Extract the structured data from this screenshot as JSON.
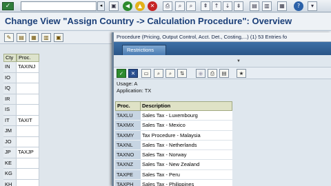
{
  "std_toolbar": {
    "buttons": [
      "back",
      "exit",
      "cancel",
      "print",
      "find",
      "find-next",
      "first-page",
      "previous-page",
      "next-page",
      "last-page",
      "create-session",
      "shortcut",
      "help",
      "customize"
    ]
  },
  "title": "Change View \"Assign Country -> Calculation Procedure\": Overview",
  "background_table": {
    "headers": [
      "Cty",
      "Proc."
    ],
    "rows": [
      {
        "cty": "IN",
        "proc": "TAXINJ"
      },
      {
        "cty": "IO",
        "proc": ""
      },
      {
        "cty": "IQ",
        "proc": ""
      },
      {
        "cty": "IR",
        "proc": ""
      },
      {
        "cty": "IS",
        "proc": ""
      },
      {
        "cty": "IT",
        "proc": "TAXIT"
      },
      {
        "cty": "JM",
        "proc": ""
      },
      {
        "cty": "JO",
        "proc": ""
      },
      {
        "cty": "JP",
        "proc": "TAXJP"
      },
      {
        "cty": "KE",
        "proc": ""
      },
      {
        "cty": "KG",
        "proc": ""
      },
      {
        "cty": "KH",
        "proc": ""
      }
    ]
  },
  "popup": {
    "title": "Procedure (Pricing, Output Control, Acct. Det., Costing,...) (1)   53 Entries fo",
    "tab_label": "Restrictions",
    "usage_line": "Usage: A",
    "application_line": "Application: TX",
    "columns": {
      "proc": "Proc.",
      "desc": "Description"
    },
    "rows": [
      {
        "proc": "TAXLU",
        "desc": "Sales Tax - Luxembourg"
      },
      {
        "proc": "TAXMX",
        "desc": "Sales Tax - Mexico"
      },
      {
        "proc": "TAXMY",
        "desc": "Tax Procedure - Malaysia"
      },
      {
        "proc": "TAXNL",
        "desc": "Sales Tax - Netherlands"
      },
      {
        "proc": "TAXNO",
        "desc": "Sales Tax - Norway"
      },
      {
        "proc": "TAXNZ",
        "desc": "Sales Tax - New Zealand"
      },
      {
        "proc": "TAXPE",
        "desc": "Sales Tax - Peru"
      },
      {
        "proc": "TAXPH",
        "desc": "Sales Tax - Philippines"
      }
    ]
  }
}
